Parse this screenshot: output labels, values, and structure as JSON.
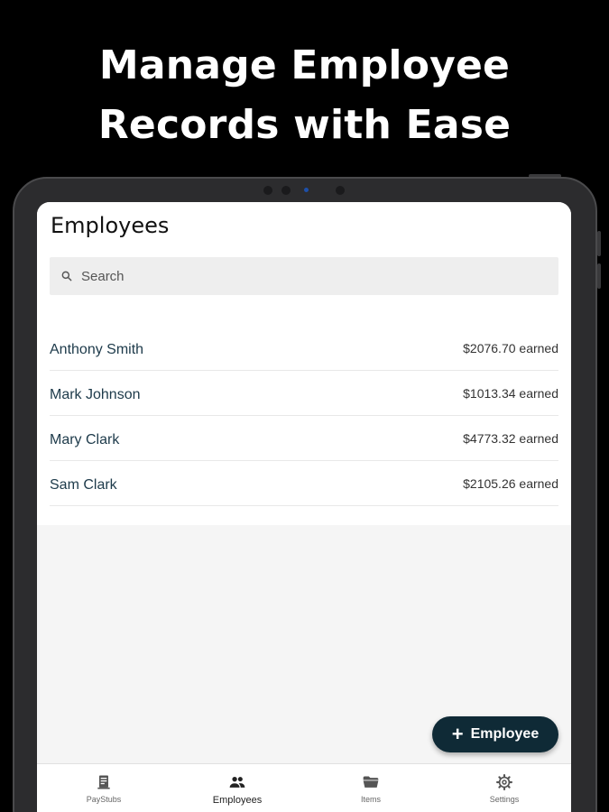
{
  "headline": {
    "line1": "Manage Employee",
    "line2": "Records with Ease"
  },
  "appbar": {
    "title": "Employees"
  },
  "search": {
    "placeholder": "Search"
  },
  "employees": [
    {
      "name": "Anthony Smith",
      "earned": "$2076.70 earned"
    },
    {
      "name": "Mark Johnson",
      "earned": "$1013.34 earned"
    },
    {
      "name": "Mary Clark",
      "earned": "$4773.32 earned"
    },
    {
      "name": "Sam Clark",
      "earned": "$2105.26 earned"
    }
  ],
  "fab": {
    "icon": "plus-icon",
    "label": "Employee"
  },
  "bottom_nav": [
    {
      "label": "PayStubs",
      "icon": "paystub-icon",
      "active": false
    },
    {
      "label": "Employees",
      "icon": "people-icon",
      "active": true
    },
    {
      "label": "Items",
      "icon": "folder-icon",
      "active": false
    },
    {
      "label": "Settings",
      "icon": "gear-icon",
      "active": false
    }
  ],
  "colors": {
    "accent": "#0f2a36",
    "employee_name": "#1d3a4a",
    "background": "#000000"
  }
}
